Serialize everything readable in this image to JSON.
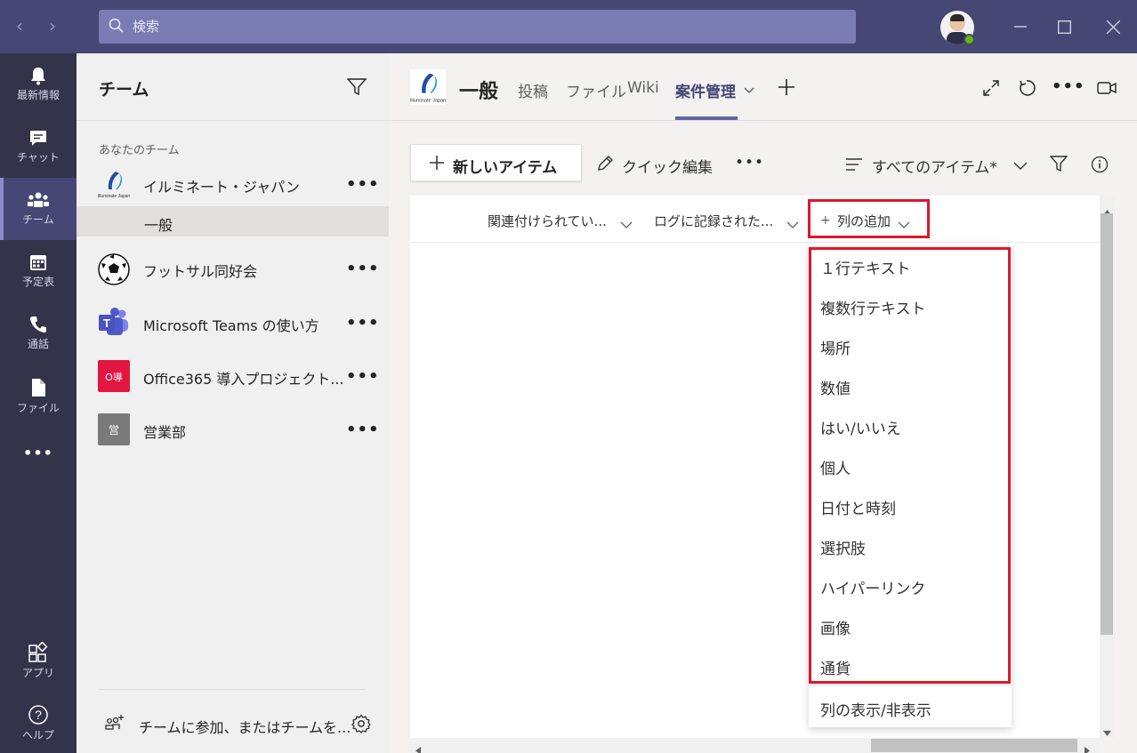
{
  "titlebar": {
    "search_placeholder": "検索",
    "window_controls": [
      "minimize",
      "maximize",
      "close"
    ]
  },
  "rail": {
    "items": [
      {
        "label": "最新情報",
        "icon": "bell-icon"
      },
      {
        "label": "チャット",
        "icon": "chat-icon"
      },
      {
        "label": "チーム",
        "icon": "teams-icon",
        "active": true
      },
      {
        "label": "予定表",
        "icon": "calendar-icon"
      },
      {
        "label": "通話",
        "icon": "phone-icon"
      },
      {
        "label": "ファイル",
        "icon": "file-icon"
      },
      {
        "label": "•••",
        "icon": "more-icon"
      }
    ],
    "bottom_items": [
      {
        "label": "アプリ",
        "icon": "apps-icon"
      },
      {
        "label": "ヘルプ",
        "icon": "help-icon"
      }
    ]
  },
  "teams_panel": {
    "title": "チーム",
    "section_label": "あなたのチーム",
    "teams": [
      {
        "name": "イルミネート・ジャパン",
        "logo": "illuminate-logo"
      },
      {
        "name": "フットサル同好会",
        "logo": "soccer-ball"
      },
      {
        "name": "Microsoft Teams の使い方",
        "logo": "teams-logo"
      },
      {
        "name": "Office365 導入プロジェクト...",
        "logo": "badge",
        "badge_text": "O導",
        "badge_color": "#e3163f"
      },
      {
        "name": "営業部",
        "logo": "badge",
        "badge_text": "営",
        "badge_color": "#7a7a7a"
      }
    ],
    "channel": "一般",
    "more": "•••",
    "footer_text": "チームに参加、またはチームを..."
  },
  "header": {
    "channel_title": "一般",
    "tabs": [
      "投稿",
      "ファイル",
      "Wiki",
      "案件管理"
    ],
    "active_tab": "案件管理",
    "add_tab": "+"
  },
  "toolbar": {
    "new_item": "新しいアイテム",
    "quick_edit": "クイック編集",
    "more": "•••",
    "view": "すべてのアイテム*"
  },
  "grid": {
    "columns": [
      "関連付けられてい...",
      "ログに記録された..."
    ],
    "add_column": "列の追加"
  },
  "menu": {
    "items": [
      "１行テキスト",
      "複数行テキスト",
      "場所",
      "数値",
      "はい/いいえ",
      "個人",
      "日付と時刻",
      "選択肢",
      "ハイパーリンク",
      "画像",
      "通貨"
    ],
    "footer_item": "列の表示/非表示"
  },
  "colors": {
    "titlebar": "#464775",
    "rail": "#33344a",
    "accent": "#6264a7",
    "highlight_red": "#e0162b"
  }
}
